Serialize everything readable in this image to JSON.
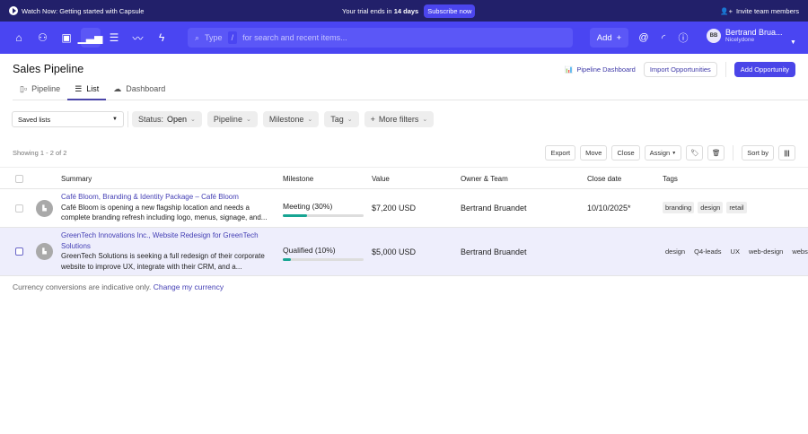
{
  "banner": {
    "watch": "Watch Now: Getting started with Capsule",
    "trial_prefix": "Your trial ends in",
    "trial_days": "14 days",
    "subscribe": "Subscribe now",
    "invite": "Invite team members"
  },
  "nav": {
    "icons": [
      "home-icon",
      "person-icon",
      "calendar-icon",
      "pipeline-chart-icon",
      "projects-icon",
      "reports-icon",
      "workflow-icon"
    ],
    "active": "pipeline-chart-icon",
    "search_type": "Type",
    "search_slash": "/",
    "search_placeholder": "for search and recent items...",
    "add": "Add",
    "user_initials": "BB",
    "user_name": "Bertrand Brua...",
    "user_org": "Nicelydone"
  },
  "page": {
    "title": "Sales Pipeline",
    "pipeline_dashboard": "Pipeline Dashboard",
    "import": "Import Opportunities",
    "add_opportunity": "Add Opportunity"
  },
  "tabs": [
    {
      "label": "Pipeline"
    },
    {
      "label": "List",
      "active": true
    },
    {
      "label": "Dashboard"
    }
  ],
  "filters": {
    "saved_lists": "Saved lists",
    "status_label": "Status:",
    "status_value": "Open",
    "pipeline": "Pipeline",
    "milestone": "Milestone",
    "tag": "Tag",
    "more": "More filters"
  },
  "list": {
    "showing": "Showing 1 - 2 of 2",
    "export": "Export",
    "move": "Move",
    "close": "Close",
    "assign": "Assign",
    "sort_by": "Sort by"
  },
  "columns": [
    "Summary",
    "Milestone",
    "Value",
    "Owner & Team",
    "Close date",
    "Tags"
  ],
  "rows": [
    {
      "name": "Café Bloom, Branding & Identity Package – Café Bloom",
      "desc": "Café Bloom is opening a new flagship location and needs a complete branding refresh including logo, menus, signage, and...",
      "milestone": "Meeting (30%)",
      "progress": 30,
      "value": "$7,200 USD",
      "owner": "Bertrand Bruandet",
      "close_date": "10/10/2025*",
      "tags": [
        "branding",
        "design",
        "retail"
      ]
    },
    {
      "name": "GreenTech Innovations Inc., Website Redesign for GreenTech Solutions",
      "desc": "GreenTech Solutions is seeking a full redesign of their corporate website to improve UX, integrate with their CRM, and a...",
      "milestone": "Qualified (10%)",
      "progress": 10,
      "value": "$5,000 USD",
      "owner": "Bertrand Bruandet",
      "close_date": "",
      "tags": [
        "design",
        "Q4-leads",
        "UX",
        "web-design",
        "website"
      ]
    }
  ],
  "footer": {
    "text": "Currency conversions are indicative only.",
    "link": "Change my currency"
  },
  "colors": {
    "banner": "#22206a",
    "nav": "#4a45f2",
    "accent": "#4a45e8",
    "progress": "#17a593",
    "selected_row": "#eeeefc"
  }
}
